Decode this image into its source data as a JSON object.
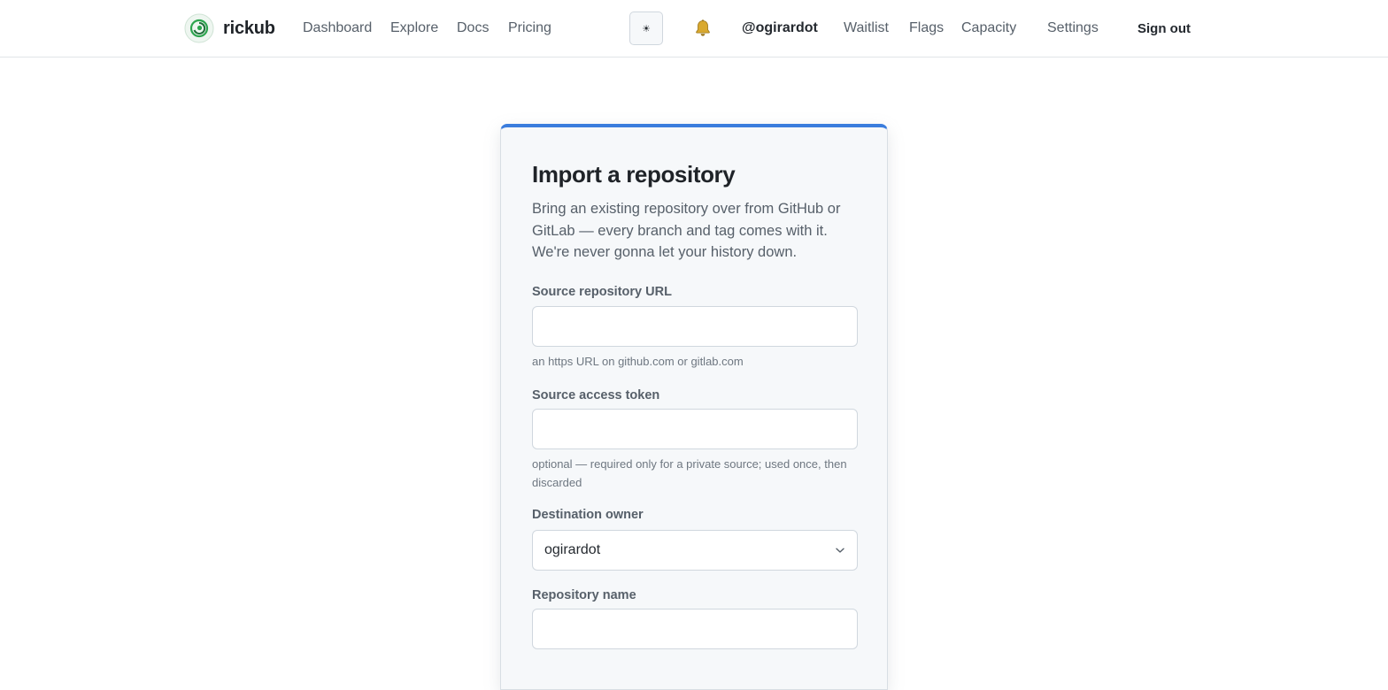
{
  "header": {
    "brand_name": "rickub",
    "nav": [
      {
        "label": "Dashboard"
      },
      {
        "label": "Explore"
      },
      {
        "label": "Docs"
      },
      {
        "label": "Pricing"
      }
    ],
    "theme_toggle_icon": "sun-icon",
    "theme_toggle_glyph": "☀",
    "notifications_icon": "bell-icon",
    "username": "@ogirardot",
    "admin_nav": [
      {
        "label": "Waitlist"
      },
      {
        "label": "Flags"
      },
      {
        "label": "Capacity"
      },
      {
        "label": "Settings"
      }
    ],
    "signout_label": "Sign out"
  },
  "form": {
    "title": "Import a repository",
    "description": "Bring an existing repository over from GitHub or GitLab — every branch and tag comes with it. We're never gonna let your history down.",
    "source_url": {
      "label": "Source repository URL",
      "value": "",
      "hint": "an https URL on github.com or gitlab.com"
    },
    "access_token": {
      "label": "Source access token",
      "value": "",
      "hint": "optional — required only for a private source; used once, then discarded"
    },
    "destination_owner": {
      "label": "Destination owner",
      "selected": "ogirardot"
    },
    "repo_name": {
      "label": "Repository name",
      "value": ""
    }
  },
  "colors": {
    "accent": "#3b7ddd",
    "logo_green": "#2da44e",
    "bell": "#d4a72c"
  }
}
